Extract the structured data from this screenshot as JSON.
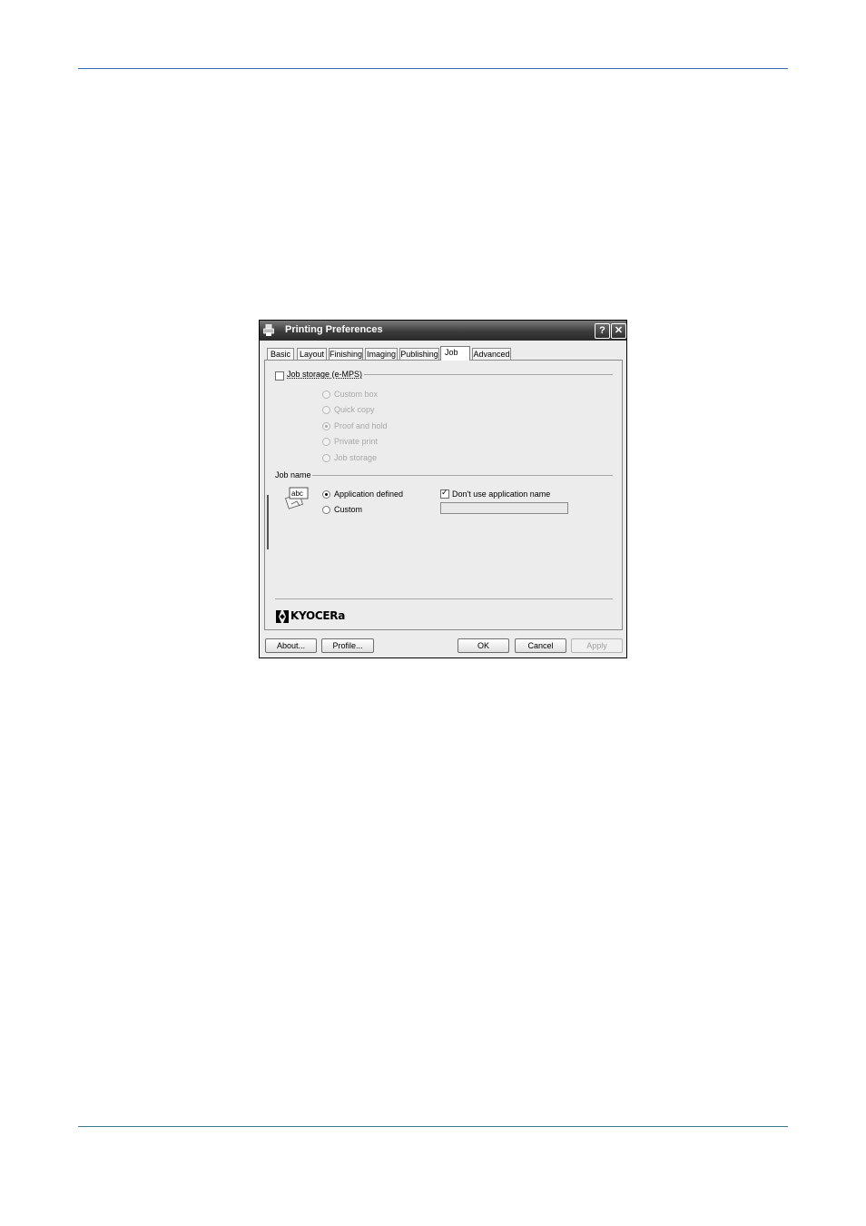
{
  "window": {
    "title": "Printing Preferences",
    "help_label": "?",
    "close_label": "✕"
  },
  "tabs": [
    {
      "label": "Basic"
    },
    {
      "label": "Layout"
    },
    {
      "label": "Finishing"
    },
    {
      "label": "Imaging"
    },
    {
      "label": "Publishing"
    },
    {
      "label": "Job",
      "active": true
    },
    {
      "label": "Advanced"
    }
  ],
  "job_storage": {
    "checkbox_label": "Job storage (e-MPS)",
    "checked": false,
    "options": [
      {
        "label": "Custom box",
        "selected": false,
        "enabled": false
      },
      {
        "label": "Quick copy",
        "selected": false,
        "enabled": false
      },
      {
        "label": "Proof and hold",
        "selected": true,
        "enabled": false
      },
      {
        "label": "Private print",
        "selected": false,
        "enabled": false
      },
      {
        "label": "Job storage",
        "selected": false,
        "enabled": false
      }
    ]
  },
  "job_name": {
    "group_label": "Job name",
    "icon_text": "abc",
    "options": [
      {
        "label": "Application defined",
        "selected": true
      },
      {
        "label": "Custom",
        "selected": false
      }
    ],
    "dont_use_app_name_label": "Don't use application name",
    "dont_use_app_name_checked": true,
    "custom_value": ""
  },
  "brand": {
    "logo_text": "KYOCERa"
  },
  "buttons": {
    "about": "About...",
    "profile": "Profile...",
    "ok": "OK",
    "cancel": "Cancel",
    "apply": "Apply"
  },
  "colors": {
    "top_rule": "#2f6fb8",
    "bottom_rule": "#3a7a8e"
  }
}
